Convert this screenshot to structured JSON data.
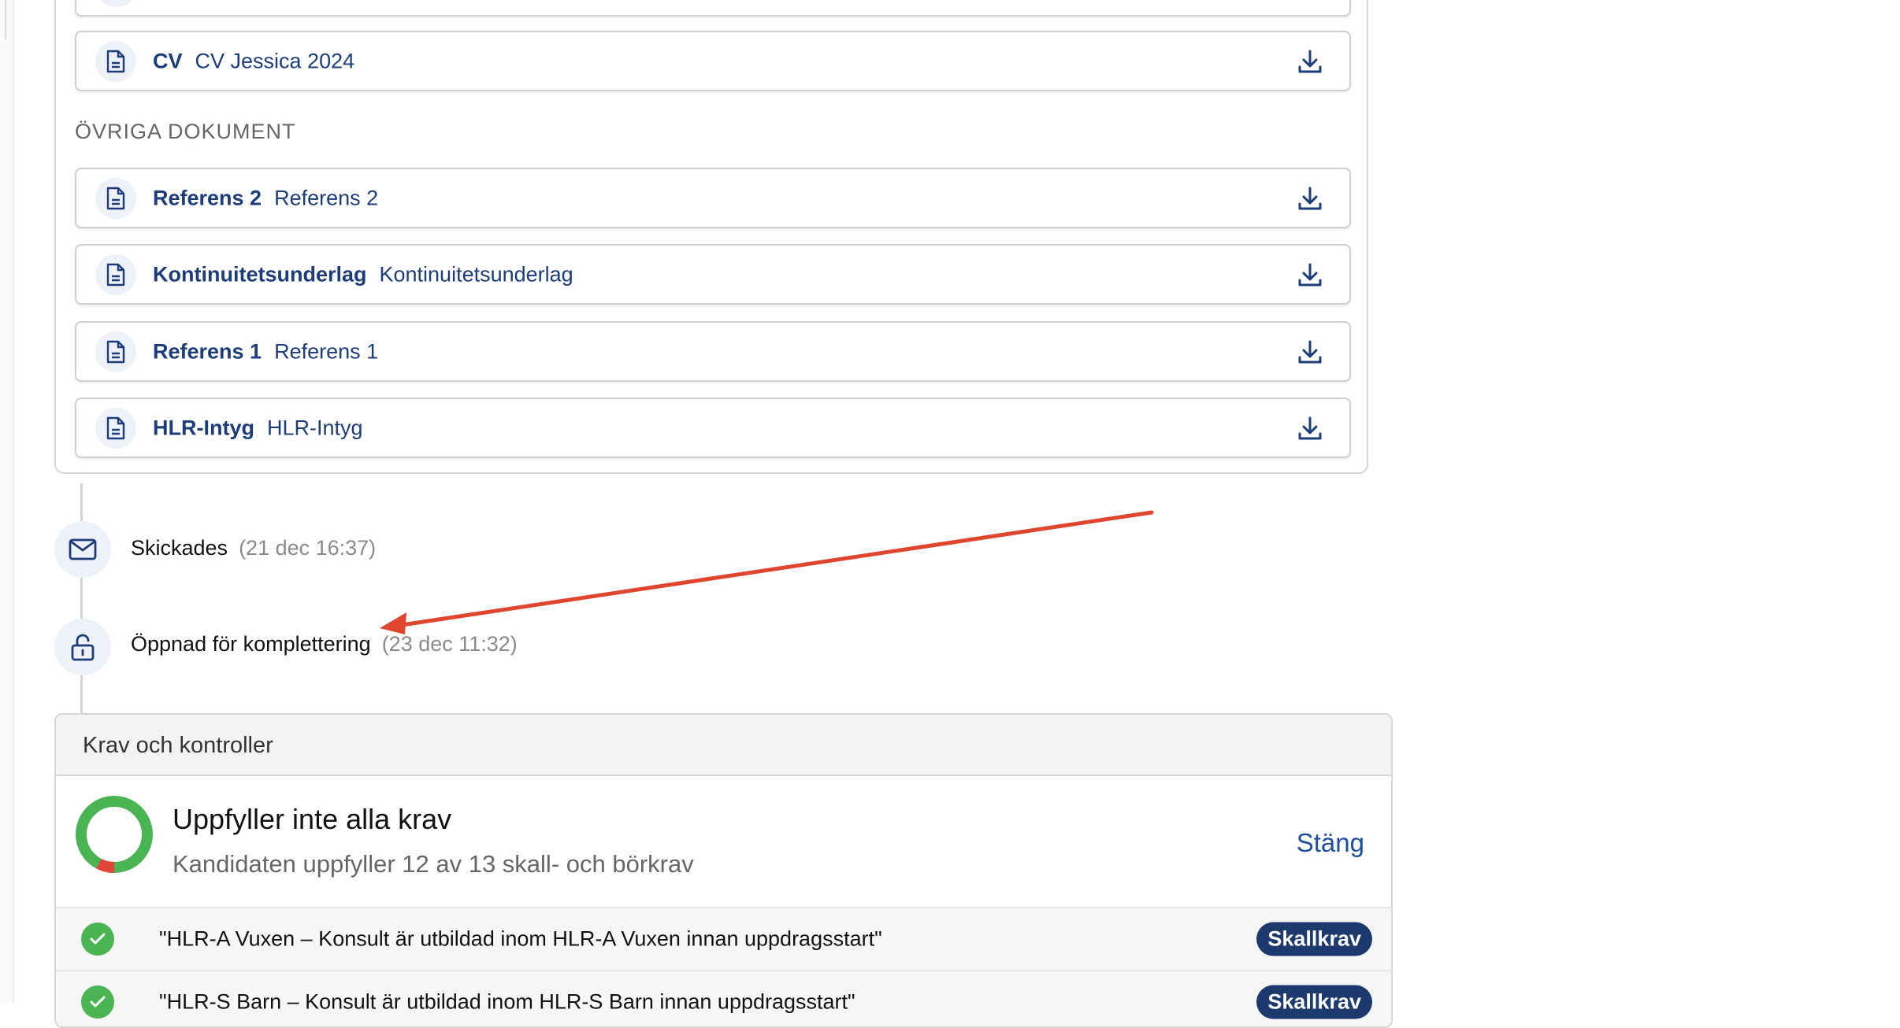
{
  "documents": {
    "cv": {
      "title": "CV",
      "filename": "CV Jessica 2024"
    },
    "other_section_label": "ÖVRIGA DOKUMENT",
    "other": [
      {
        "title": "Referens 2",
        "filename": "Referens 2"
      },
      {
        "title": "Kontinuitetsunderlag",
        "filename": "Kontinuitetsunderlag"
      },
      {
        "title": "Referens 1",
        "filename": "Referens 1"
      },
      {
        "title": "HLR-Intyg",
        "filename": "HLR-Intyg"
      }
    ]
  },
  "timeline": [
    {
      "label": "Skickades",
      "time": "(21 dec 16:37)",
      "icon": "envelope-icon"
    },
    {
      "label": "Öppnad för komplettering",
      "time": "(23 dec 11:32)",
      "icon": "unlock-icon"
    }
  ],
  "requirements": {
    "header": "Krav och kontroller",
    "title": "Uppfyller inte alla krav",
    "subtitle": "Kandidaten uppfyller 12 av 13 skall- och börkrav",
    "met": 12,
    "total": 13,
    "close_label": "Stäng",
    "items": [
      {
        "text": "\"HLR-A Vuxen – Konsult är utbildad inom HLR-A Vuxen innan uppdragsstart\"",
        "badge": "Skallkrav",
        "status": "met"
      },
      {
        "text": "\"HLR-S Barn – Konsult är utbildad inom HLR-S Barn innan uppdragsstart\"",
        "badge": "Skallkrav",
        "status": "met"
      }
    ]
  },
  "colors": {
    "accent": "#1c3d7a",
    "success": "#4ab453",
    "fail": "#e0443a",
    "annotation": "#e0452f"
  }
}
